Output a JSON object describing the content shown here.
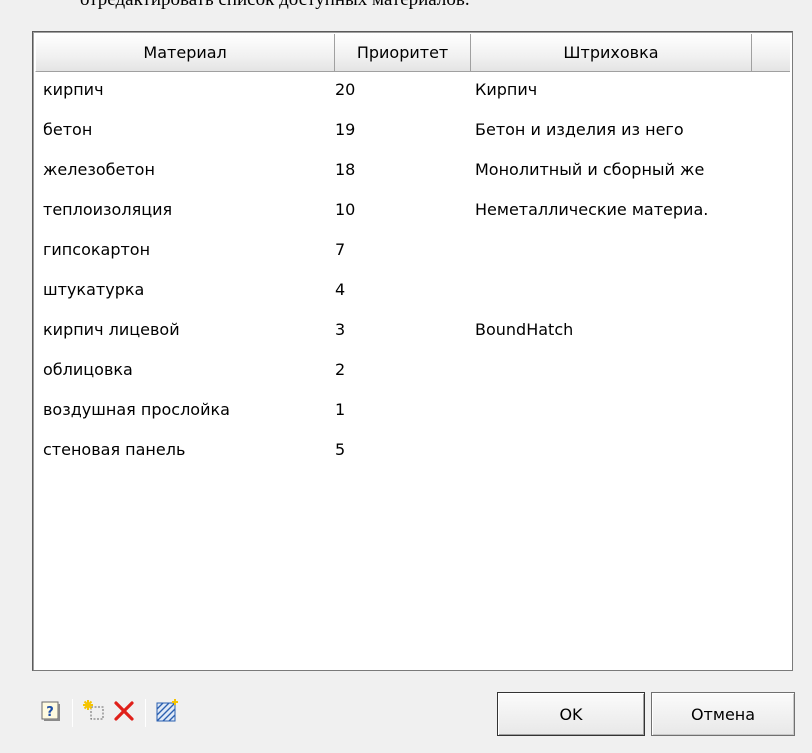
{
  "top_text": "отредактировать список доступных материалов.",
  "table": {
    "columns": [
      "Материал",
      "Приоритет",
      "Штриховка",
      ""
    ],
    "rows": [
      {
        "material": "кирпич",
        "priority": "20",
        "hatch": "Кирпич"
      },
      {
        "material": "бетон",
        "priority": "19",
        "hatch": "Бетон и изделия из него"
      },
      {
        "material": "железобетон",
        "priority": "18",
        "hatch": "Монолитный и сборный же"
      },
      {
        "material": "теплоизоляция",
        "priority": "10",
        "hatch": "Неметаллические материа."
      },
      {
        "material": "гипсокартон",
        "priority": "7",
        "hatch": ""
      },
      {
        "material": "штукатурка",
        "priority": "4",
        "hatch": ""
      },
      {
        "material": "кирпич лицевой",
        "priority": "3",
        "hatch": "BoundHatch"
      },
      {
        "material": "облицовка",
        "priority": "2",
        "hatch": ""
      },
      {
        "material": "воздушная прослойка",
        "priority": "1",
        "hatch": ""
      },
      {
        "material": "стеновая панель",
        "priority": "5",
        "hatch": ""
      }
    ]
  },
  "toolbar": {
    "icons": [
      "help-icon",
      "new-item-icon",
      "delete-icon",
      "edit-hatch-icon"
    ]
  },
  "buttons": {
    "ok_label": "OK",
    "cancel_label": "Отмена"
  },
  "colors": {
    "delete_red": "#e0201a",
    "new_item_yellow": "#f5c400",
    "hatch_blue": "#2a5fb0"
  }
}
